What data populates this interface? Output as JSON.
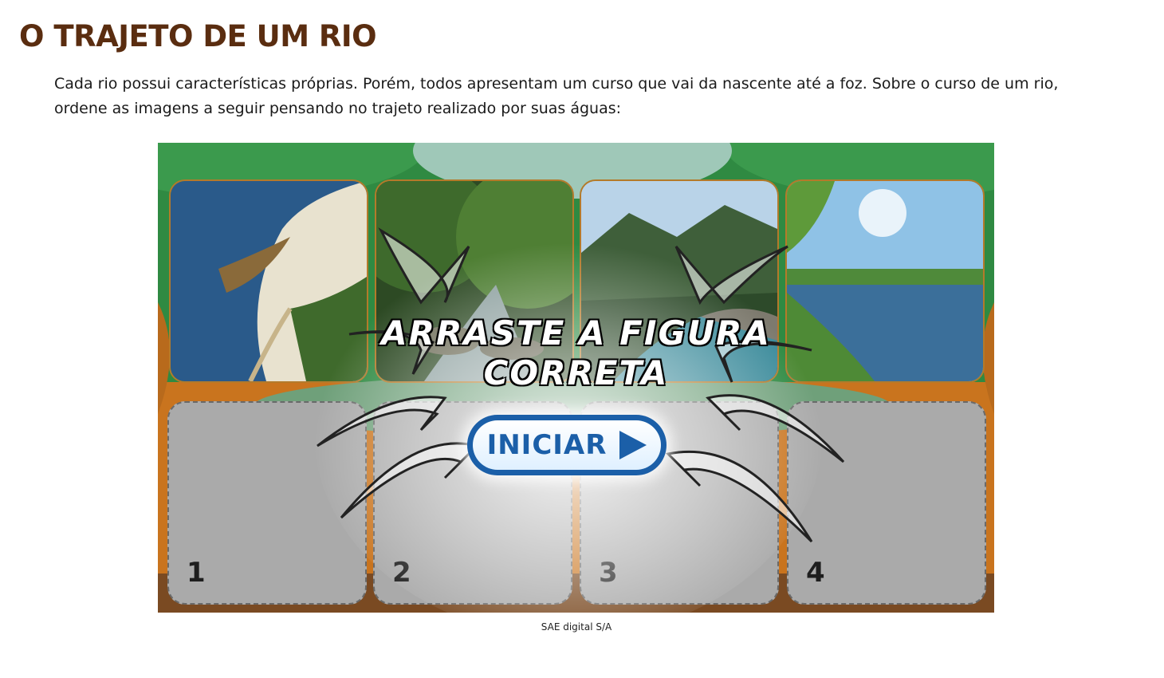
{
  "page": {
    "title": "O TRAJETO DE UM RIO",
    "intro": "Cada rio possui características próprias. Porém, todos apresentam um curso que vai da nascente até a foz. Sobre o curso de um rio, ordene as imagens a seguir pensando no trajeto realizado por suas águas:",
    "credit": "SAE digital S/A"
  },
  "game": {
    "instruction_line1": "ARRASTE A FIGURA",
    "instruction_line2": "CORRETA",
    "start_label": "INICIAR",
    "photos": [
      {
        "name": "river-mouth-photo",
        "icon": "delta-beach-image"
      },
      {
        "name": "forest-stream-photo",
        "icon": "forest-stream-image"
      },
      {
        "name": "mountain-river-photo",
        "icon": "mountain-river-image"
      },
      {
        "name": "plain-river-photo",
        "icon": "plain-river-image"
      }
    ],
    "slots": [
      {
        "number": "1"
      },
      {
        "number": "2"
      },
      {
        "number": "3"
      },
      {
        "number": "4"
      }
    ]
  },
  "colors": {
    "title": "#5a2d10",
    "game_green": "#2e7d3e",
    "button_blue": "#1b5fa8",
    "frame_brown": "#b47a2a",
    "slot_grey": "#aaaaaa"
  }
}
